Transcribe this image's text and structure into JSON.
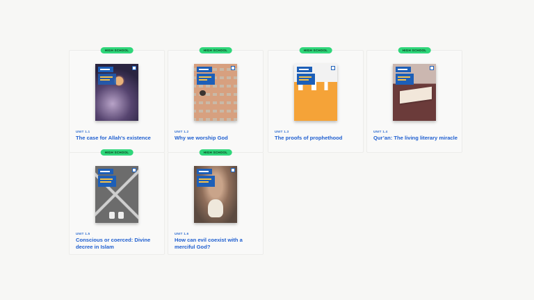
{
  "cards": [
    {
      "badge": "HIGH SCHOOL",
      "unit": "UNIT 1.1",
      "title": "The case for Allah's existence",
      "cover_icon": "galaxy-cover"
    },
    {
      "badge": "HIGH SCHOOL",
      "unit": "UNIT 1.2",
      "title": "Why we worship God",
      "cover_icon": "tiles-cover"
    },
    {
      "badge": "HIGH SCHOOL",
      "unit": "UNIT 1.3",
      "title": "The proofs of prophethood",
      "cover_icon": "orange-city-cover"
    },
    {
      "badge": "HIGH SCHOOL",
      "unit": "UNIT 1.4",
      "title": "Qur’an: The living literary miracle",
      "cover_icon": "book-cover"
    },
    {
      "badge": "HIGH SCHOOL",
      "unit": "UNIT 1.5",
      "title": "Conscious or coerced: Divine decree in Islam",
      "cover_icon": "crossroads-cover"
    },
    {
      "badge": "HIGH SCHOOL",
      "unit": "UNIT 1.6",
      "title": "How can evil coexist with a merciful God?",
      "cover_icon": "child-cover"
    }
  ],
  "colors": {
    "badge": "#2fd67a",
    "title": "#1f5fd0",
    "brand": "#1d5fb8"
  }
}
